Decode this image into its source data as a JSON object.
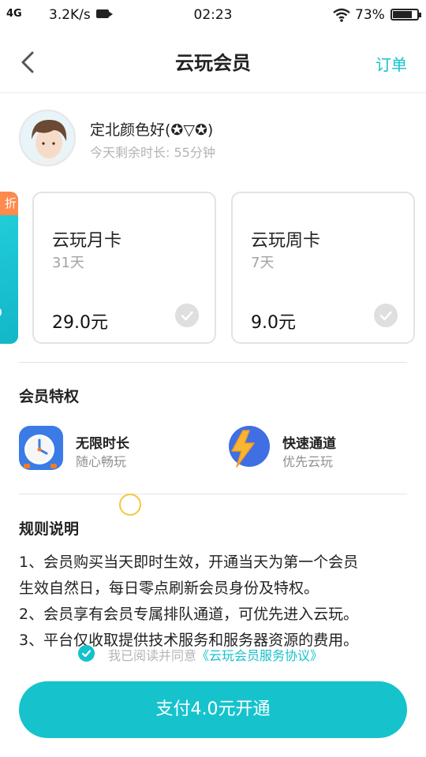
{
  "status_bar": {
    "network": "4G",
    "speed": "3.2K/s",
    "time": "02:23",
    "battery": "73%"
  },
  "header": {
    "title": "云玩会员",
    "action": "订单"
  },
  "user": {
    "name": "定北颜色好(✪▽✪)",
    "remaining": "今天剩余时长: 55分钟"
  },
  "edge_card": {
    "tag": "折"
  },
  "plans": [
    {
      "name": "云玩月卡",
      "duration": "31天",
      "price": "29.0元"
    },
    {
      "name": "云玩周卡",
      "duration": "7天",
      "price": "9.0元"
    }
  ],
  "privileges": {
    "title": "会员特权",
    "items": [
      {
        "title": "无限时长",
        "subtitle": "随心畅玩",
        "icon": "clock-icon"
      },
      {
        "title": "快速通道",
        "subtitle": "优先云玩",
        "icon": "lightning-icon"
      }
    ]
  },
  "rules": {
    "title": "规则说明",
    "lines": [
      "1、会员购买当天即时生效，开通当天为第一个会员",
      "生效自然日，每日零点刷新会员身份及特权。",
      "2、会员享有会员专属排队通道，可优先进入云玩。",
      "3、平台仅收取提供技术服务和服务器资源的费用。"
    ]
  },
  "agreement": {
    "text": "我已阅读并同意",
    "link": "《云玩会员服务协议》"
  },
  "pay_button": "支付4.0元开通",
  "colors": {
    "accent": "#14c2cc",
    "tag": "#ff8a4c",
    "loading_ring": "#f4c742"
  }
}
